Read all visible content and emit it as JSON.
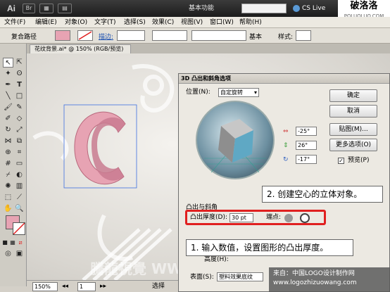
{
  "titlebar": {
    "app_logo": "Ai",
    "workspace": "基本功能",
    "cslive": "CS Live",
    "watermark_cn": "破洛洛",
    "watermark_url": "POLUOLUO.COM"
  },
  "menu": [
    "文件(F)",
    "编辑(E)",
    "对象(O)",
    "文字(T)",
    "选择(S)",
    "效果(C)",
    "视图(V)",
    "窗口(W)",
    "帮助(H)"
  ],
  "controlbar": {
    "path_label": "复合路径",
    "stroke_label": "描边:",
    "basic_label": "基本",
    "style_label": "样式:"
  },
  "document": {
    "tab_title": "花纹背景.ai* @ 150% (RGB/预览)",
    "zoom": "150%",
    "page": "1",
    "status": "选择"
  },
  "dialog": {
    "title": "3D 凸出和斜角选项",
    "position_label": "位置(N):",
    "position_value": "自定旋转",
    "angle_x": "-25°",
    "angle_y": "26°",
    "angle_z": "-17°",
    "ok_button": "确定",
    "cancel_button": "取消",
    "map_button": "贴图(M)...",
    "more_button": "更多选项(O)",
    "preview_label": "预览(P)",
    "extrude_section": "凸出与斜角",
    "extrude_depth_label": "凸出厚度(D):",
    "extrude_depth_value": "30 pt",
    "cap_label": "端点:",
    "height_label": "高度(H):",
    "surface_label": "表面(S):",
    "surface_value": "塑料效果底纹"
  },
  "annotations": {
    "step1": "1. 输入数值，设置图形的凸出厚度。",
    "step2": "2. 创建空心的立体对象。"
  },
  "watermark_bottom": {
    "line1": "来自：中国LOGO设计制作网",
    "line2": "www.logozhizuowang.com"
  },
  "colors": {
    "selection_red": "#e02020",
    "cube_face": "#5fa8c4",
    "shape_pink": "#e7a3b3"
  }
}
